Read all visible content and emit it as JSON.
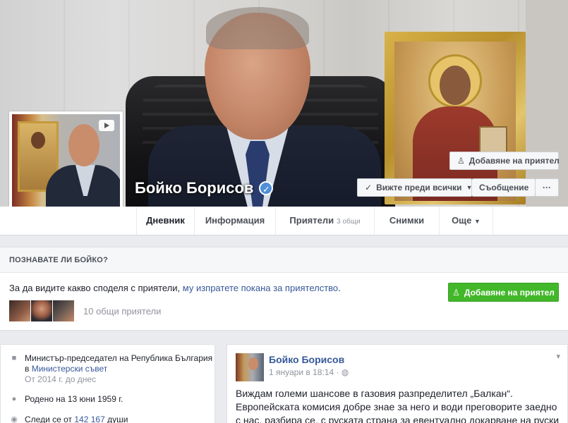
{
  "profile": {
    "name": "Бойко Борисов",
    "verified_icon": "check-badge-icon",
    "accent": "#4f8ed9"
  },
  "cover_actions": {
    "add_friend": "Добавяне на приятел",
    "follow": "Вижте преди всички",
    "message": "Съобщение",
    "more": "···"
  },
  "tabs": [
    {
      "label": "Дневник"
    },
    {
      "label": "Информация"
    },
    {
      "label": "Приятели",
      "count": "3 общи"
    },
    {
      "label": "Снимки"
    },
    {
      "label": "Още"
    }
  ],
  "know_card": {
    "header": "ПОЗНАВАТЕ ЛИ БОЙКО?",
    "text_prefix": "За да видите какво споделя с приятели, ",
    "text_link": "му изпратете покана за приятелство",
    "text_suffix": ".",
    "add_friend": "Добавяне на приятел",
    "add_friend_color": "#42b72a",
    "mutual": "10 общи приятели"
  },
  "intro": {
    "job_title": "Министър-председател на Република България",
    "job_in": "в ",
    "job_org": "Министерски съвет",
    "job_since": "От 2014 г. до днес",
    "born": "Родено на 13 юни 1959 г.",
    "follow_prefix": "Следи се от ",
    "follow_count": "142 167",
    "follow_suffix": " души"
  },
  "post": {
    "author": "Бойко Борисов",
    "date": "1 януари в 18:14",
    "privacy_icon": "globe-icon",
    "body": "Виждам големи шансове в газовия разпределител „Балкан“. Европейската комисия добре знае за него и води преговорите заедно с нас, разбира се, с руската страна за евентуално докарване на руски газ"
  }
}
